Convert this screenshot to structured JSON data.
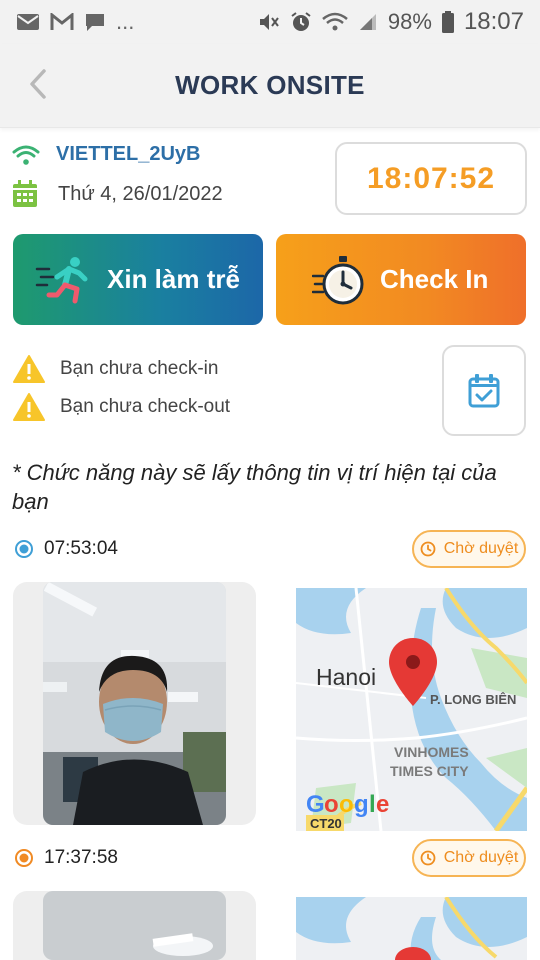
{
  "status_bar": {
    "battery": "98%",
    "time": "18:07",
    "icons": [
      "email-icon",
      "gmail-icon",
      "chat-icon",
      "more-dots",
      "mute-icon",
      "alarm-icon",
      "wifi-icon",
      "signal-icon",
      "battery-icon"
    ]
  },
  "header": {
    "title": "WORK ONSITE",
    "back_icon": "chevron-left-icon"
  },
  "info": {
    "wifi_name": "VIETTEL_2UyB",
    "date": "Thứ 4, 26/01/2022",
    "clock": "18:07:52"
  },
  "actions": {
    "late_label": "Xin làm trễ",
    "checkin_label": "Check In"
  },
  "warnings": {
    "checkin": "Bạn chưa check-in",
    "checkout": "Bạn chưa check-out"
  },
  "notice": "* Chức năng này sẽ lấy thông tin vị trí hiện tại của bạn",
  "records": [
    {
      "time": "07:53:04",
      "status": "Chờ duyệt",
      "map": {
        "city": "Hanoi",
        "district": "P. LONG BIÊN",
        "area_line1": "VINHOMES",
        "area_line2": "TIMES CITY",
        "road": "CT20",
        "provider": "Google"
      }
    },
    {
      "time": "17:37:58",
      "status": "Chờ duyệt"
    }
  ],
  "colors": {
    "accent_orange": "#f59d25",
    "title_navy": "#2b3a55",
    "wifi_blue": "#2d6fa7",
    "late_gradient": [
      "#1e9a6e",
      "#1c67a8"
    ],
    "checkin_gradient": [
      "#f6a01a",
      "#ef6f2a"
    ]
  }
}
